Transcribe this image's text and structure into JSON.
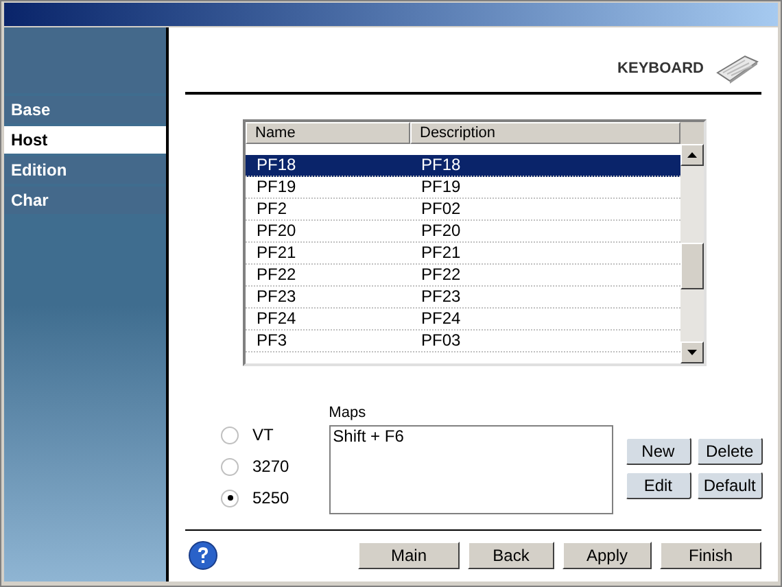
{
  "sidebar": {
    "items": [
      {
        "label": "Base",
        "selected": false
      },
      {
        "label": "Host",
        "selected": true
      },
      {
        "label": "Edition",
        "selected": false
      },
      {
        "label": "Char",
        "selected": false
      }
    ]
  },
  "header": {
    "title": "KEYBOARD"
  },
  "table": {
    "columns": [
      "Name",
      "Description"
    ],
    "rows": [
      {
        "name": "PF18",
        "description": "PF18",
        "selected": true
      },
      {
        "name": "PF19",
        "description": "PF19",
        "selected": false
      },
      {
        "name": "PF2",
        "description": "PF02",
        "selected": false
      },
      {
        "name": "PF20",
        "description": "PF20",
        "selected": false
      },
      {
        "name": "PF21",
        "description": "PF21",
        "selected": false
      },
      {
        "name": "PF22",
        "description": "PF22",
        "selected": false
      },
      {
        "name": "PF23",
        "description": "PF23",
        "selected": false
      },
      {
        "name": "PF24",
        "description": "PF24",
        "selected": false
      },
      {
        "name": "PF3",
        "description": "PF03",
        "selected": false
      }
    ]
  },
  "terminal_types": [
    {
      "label": "VT",
      "selected": false
    },
    {
      "label": "3270",
      "selected": false
    },
    {
      "label": "5250",
      "selected": true
    }
  ],
  "maps": {
    "label": "Maps",
    "value": "Shift + F6"
  },
  "map_buttons": [
    "New",
    "Delete",
    "Edit",
    "Default"
  ],
  "footer_buttons": [
    "Main",
    "Back",
    "Apply",
    "Finish"
  ]
}
